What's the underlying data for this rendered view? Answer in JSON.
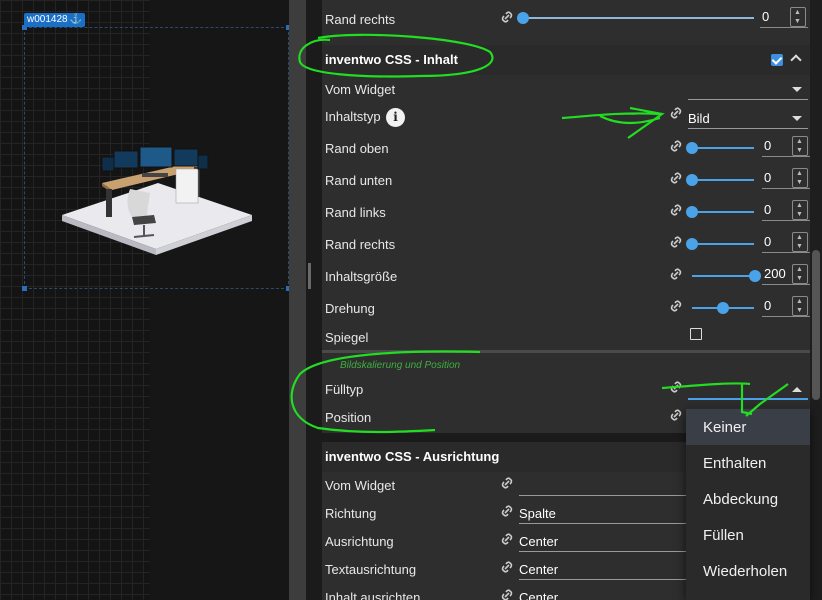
{
  "canvas": {
    "widget_id": "w001428",
    "anchor_glyph": "⚓"
  },
  "panel": {
    "top_row": {
      "label": "Rand rechts",
      "value": "0"
    },
    "section_inhalt": {
      "title": "inventwo CSS - Inhalt",
      "enabled": true,
      "rows": {
        "vom_widget": {
          "label": "Vom Widget",
          "value": ""
        },
        "inhaltstyp": {
          "label": "Inhaltstyp",
          "value": "Bild",
          "info_glyph": "i"
        },
        "rand_oben": {
          "label": "Rand oben",
          "value": "0"
        },
        "rand_unten": {
          "label": "Rand unten",
          "value": "0"
        },
        "rand_links": {
          "label": "Rand links",
          "value": "0"
        },
        "rand_rechts": {
          "label": "Rand rechts",
          "value": "0"
        },
        "inhaltsgroesse": {
          "label": "Inhaltsgröße",
          "value": "200"
        },
        "drehung": {
          "label": "Drehung",
          "value": "0"
        },
        "spiegel": {
          "label": "Spiegel",
          "checked": false
        }
      },
      "subgroup_title": "Bildskalierung und Position",
      "fuelltyp": {
        "label": "Fülltyp",
        "value": ""
      },
      "position": {
        "label": "Position"
      }
    },
    "section_ausrichtung": {
      "title": "inventwo CSS - Ausrichtung",
      "rows": {
        "vom_widget": {
          "label": "Vom Widget",
          "value": ""
        },
        "richtung": {
          "label": "Richtung",
          "value": "Spalte"
        },
        "ausrichtung": {
          "label": "Ausrichtung",
          "value": "Center"
        },
        "textausrichtung": {
          "label": "Textausrichtung",
          "value": "Center"
        },
        "inhalt_ausrichten": {
          "label": "Inhalt ausrichten",
          "value": "Center"
        }
      }
    }
  },
  "dropdown": {
    "options": [
      "Keiner",
      "Enthalten",
      "Abdeckung",
      "Füllen",
      "Wiederholen"
    ],
    "highlighted": "Keiner"
  },
  "colors": {
    "accent": "#4aa3e8",
    "annotation": "#22dd22",
    "panel_bg": "#2e2e2e"
  }
}
